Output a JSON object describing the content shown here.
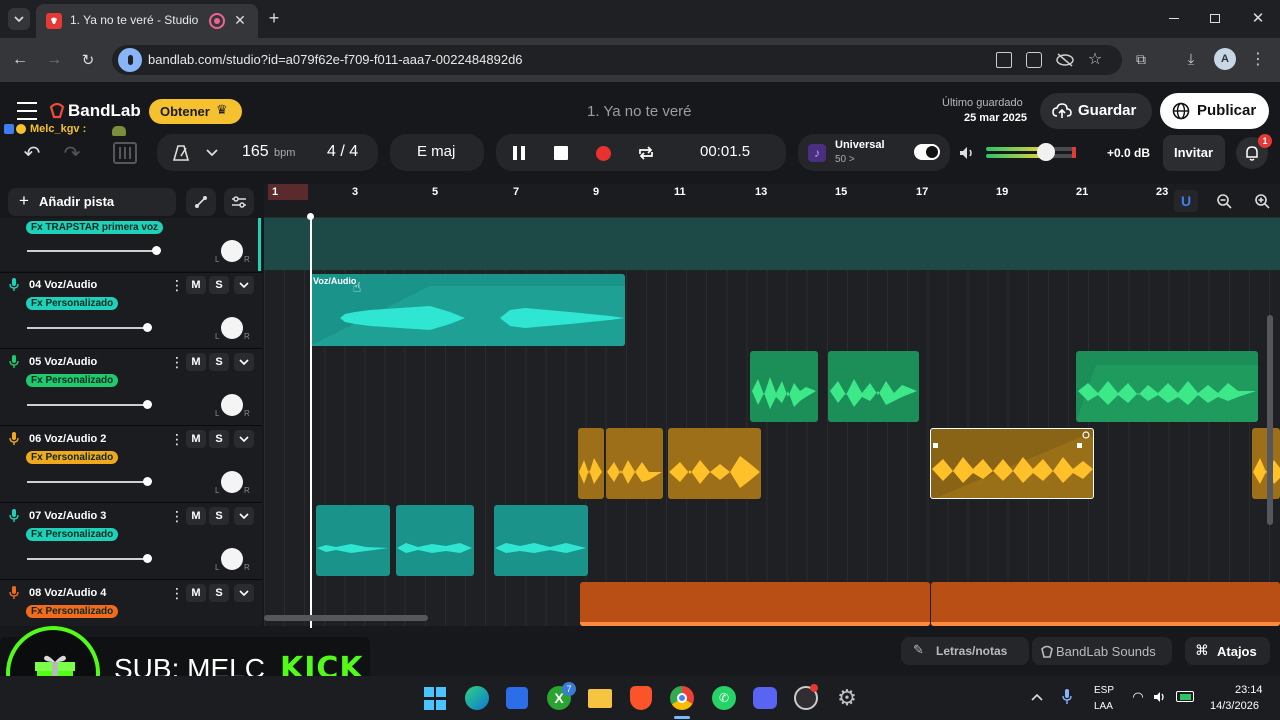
{
  "browser": {
    "tab_title": "1. Ya no te veré - Studio",
    "url": "bandlab.com/studio?id=a079f62e-f709-f011-aaa7-0022484892d6"
  },
  "header": {
    "logo": "BandLab",
    "obtener": "Obtener",
    "project_title": "1. Ya no te veré",
    "user": "Melc_kgv :",
    "last_saved_label": "Último guardado",
    "last_saved_date": "25 mar 2025",
    "guardar": "Guardar",
    "publicar": "Publicar"
  },
  "transport": {
    "bpm_value": "165",
    "bpm_unit": "bpm",
    "time_sig": "4 / 4",
    "key": "E maj",
    "time": "00:01.5",
    "universal": "Universal",
    "universal_sub": "50 >",
    "gain": "+0.0 dB",
    "invitar": "Invitar",
    "notif_count": "1"
  },
  "timeline": {
    "add_track": "Añadir pista",
    "bars": [
      "1",
      "3",
      "5",
      "7",
      "9",
      "11",
      "13",
      "15",
      "17",
      "19",
      "21",
      "23"
    ]
  },
  "tracks": [
    {
      "name": "",
      "fx": "Fx TRAPSTAR primera voz",
      "color": "#1fd1b8"
    },
    {
      "name": "04  Voz/Audio",
      "fx": "Fx Personalizado",
      "color": "#1fd1b8",
      "clip_label": "Voz/Audio"
    },
    {
      "name": "05  Voz/Audio",
      "fx": "Fx Personalizado",
      "color": "#20c86e"
    },
    {
      "name": "06  Voz/Audio 2",
      "fx": "Fx Personalizado",
      "color": "#f0a81c"
    },
    {
      "name": "07  Voz/Audio 3",
      "fx": "Fx Personalizado",
      "color": "#1fd1b8"
    },
    {
      "name": "08  Voz/Audio 4",
      "fx": "Fx Personalizado",
      "color": "#f26a1b"
    }
  ],
  "ms": {
    "m": "M",
    "s": "S"
  },
  "pan": {
    "l": "L",
    "r": "R"
  },
  "bottom": {
    "letras": "Letras/notas",
    "sounds": "BandLab Sounds",
    "atajos": "Atajos"
  },
  "overlay": {
    "sub_text": "SUB: MELC",
    "kick": "KICK"
  },
  "system": {
    "lang1": "ESP",
    "lang2": "LAA",
    "time": "23:14",
    "date": "14/3/2026",
    "xbox_badge": "7"
  }
}
